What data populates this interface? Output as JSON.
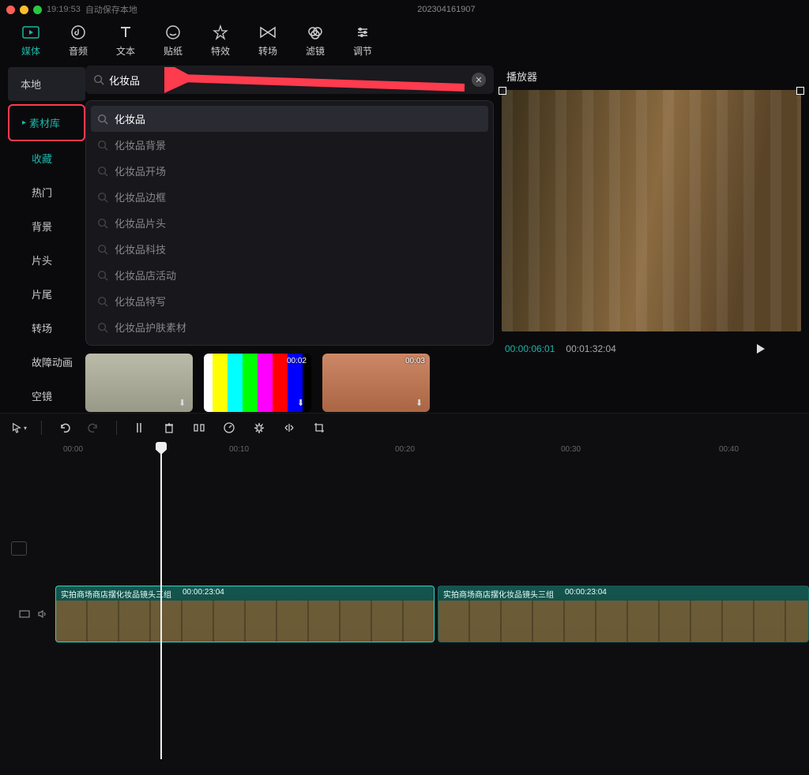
{
  "titlebar": {
    "time": "19:19:53",
    "autosave": "自动保存本地",
    "project": "202304161907"
  },
  "toptabs": [
    {
      "label": "媒体"
    },
    {
      "label": "音频"
    },
    {
      "label": "文本"
    },
    {
      "label": "贴纸"
    },
    {
      "label": "特效"
    },
    {
      "label": "转场"
    },
    {
      "label": "滤镜"
    },
    {
      "label": "调节"
    }
  ],
  "sidebar": {
    "local": "本地",
    "library": "素材库",
    "favorites": "收藏",
    "hot": "热门",
    "background": "背景",
    "opener": "片头",
    "ending": "片尾",
    "transition": "转场",
    "glitch": "故障动画",
    "empty": "空镜"
  },
  "search": {
    "query": "化妆品",
    "suggestions": [
      "化妆品",
      "化妆品背景",
      "化妆品开场",
      "化妆品边框",
      "化妆品片头",
      "化妆品科技",
      "化妆品店活动",
      "化妆品特写",
      "化妆品护肤素材"
    ]
  },
  "thumbs": [
    {
      "dur": ""
    },
    {
      "dur": "00:02"
    },
    {
      "dur": "00:03"
    }
  ],
  "player": {
    "title": "播放器",
    "current": "00:00:06:01",
    "total": "00:01:32:04"
  },
  "ruler": [
    "00:00",
    "00:10",
    "00:20",
    "00:30",
    "00:40"
  ],
  "clips": [
    {
      "title": "实拍商场商店摆化妆品镜头三组",
      "dur": "00:00:23:04"
    },
    {
      "title": "实拍商场商店摆化妆品镜头三组",
      "dur": "00:00:23:04"
    }
  ]
}
